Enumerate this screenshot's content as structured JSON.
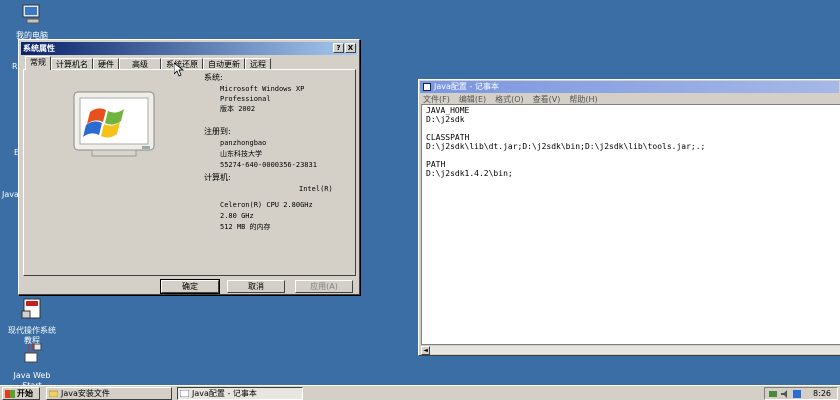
{
  "desktop": {
    "icons": [
      {
        "label": "我的电脑"
      },
      {
        "label_line1": "现代操作系统",
        "label_line2": "教程"
      },
      {
        "label_line1": "Java Web",
        "label_line2": "Start"
      }
    ],
    "edge_labels": [
      "R",
      "E",
      "Java"
    ]
  },
  "sysprops": {
    "title": "系统属性",
    "help_btn": "?",
    "close_btn": "X",
    "tabs": [
      "常规",
      "计算机名",
      "硬件",
      "高级",
      "系统还原",
      "自动更新",
      "远程"
    ],
    "system_header": "系统:",
    "os_name": "Microsoft Windows XP",
    "os_edition": "Professional",
    "os_version": "版本 2002",
    "registered_header": "注册到:",
    "user": "panzhongbao",
    "organization": "山东科技大学",
    "product_id": "55274-640-0000356-23831",
    "computer_header": "计算机:",
    "cpu_vendor": "Intel(R)",
    "cpu_model": "Celeron(R) CPU 2.80GHz",
    "cpu_speed": "2.80 GHz",
    "memory": "512 MB 的内存",
    "ok": "确定",
    "cancel": "取消",
    "apply": "应用(A)"
  },
  "notepad": {
    "title": "Java配置 - 记事本",
    "menu": [
      "文件(F)",
      "编辑(E)",
      "格式(O)",
      "查看(V)",
      "帮助(H)"
    ],
    "content": "JAVA_HOME\nD:\\j2sdk\n\nCLASSPATH\nD:\\j2sdk\\lib\\dt.jar;D:\\j2sdk\\bin;D:\\j2sdk\\lib\\tools.jar;.;\n\nPATH\nD:\\j2sdk1.4.2\\bin;"
  },
  "taskbar": {
    "start": "开始",
    "tasks": [
      "Java安装文件",
      "Java配置 - 记事本"
    ],
    "clock": "8:26"
  }
}
